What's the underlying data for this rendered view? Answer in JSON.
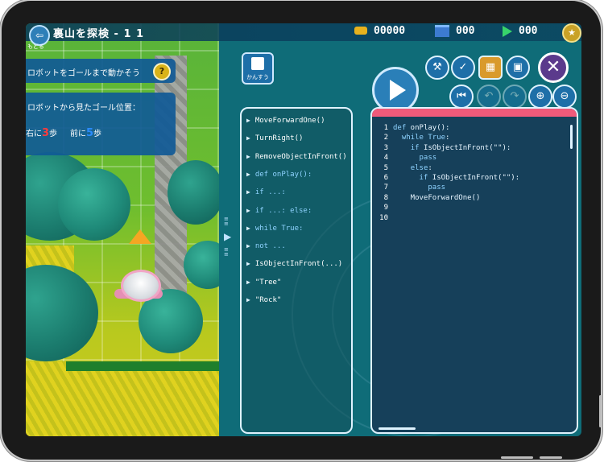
{
  "header": {
    "stage_title": "裏山を探検 - 1 1",
    "back_label": "もどる",
    "coins": "00000",
    "boxes": "000",
    "plays": "000"
  },
  "mission": {
    "text": "ロボットをゴールまで動かそう",
    "help": "?"
  },
  "goal_info": {
    "title": "ロボットから見たゴール位置：",
    "right_prefix": "右に",
    "right_value": "3",
    "right_suffix": "歩",
    "front_prefix": "前に",
    "front_value": "5",
    "front_suffix": "歩"
  },
  "toolbox": {
    "hints_label": "かんすう",
    "items": [
      {
        "text": "MoveForwardOne()",
        "kw": false
      },
      {
        "text": "TurnRight()",
        "kw": false
      },
      {
        "text": "RemoveObjectInFront()",
        "kw": false
      },
      {
        "text": "def onPlay():",
        "kw": true
      },
      {
        "text": "if ...:",
        "kw": true
      },
      {
        "text": "if ...: else:",
        "kw": true
      },
      {
        "text": "while True:",
        "kw": true
      },
      {
        "text": "not ...",
        "kw": true
      },
      {
        "text": "IsObjectInFront(...)",
        "kw": false
      },
      {
        "text": "\"Tree\"",
        "kw": false
      },
      {
        "text": "\"Rock\"",
        "kw": false
      }
    ]
  },
  "editor": {
    "line_numbers": [
      "1",
      "2",
      "3",
      "4",
      "5",
      "6",
      "7",
      "8",
      "9",
      "10"
    ],
    "code_lines": [
      "def onPlay():",
      "  while True:",
      "    if IsObjectInFront(\"\"):",
      "      pass",
      "    else:",
      "      if IsObjectInFront(\"\"):",
      "        pass",
      "    MoveForwardOne()",
      "",
      ""
    ]
  },
  "icons": {
    "back": "back-arrow-icon",
    "coin": "coin-icon",
    "box": "box-icon",
    "play_count": "play-icon",
    "trophy": "trophy-icon",
    "wrench": "wrench-icon",
    "check": "check-icon",
    "folder": "folder-icon",
    "window": "window-icon",
    "close": "close-icon",
    "run": "run-play-icon",
    "rewind": "rewind-icon",
    "undo": "undo-icon",
    "redo": "redo-icon",
    "zoom_in": "zoom-in-icon",
    "zoom_out": "zoom-out-icon"
  },
  "colors": {
    "accent_red": "#ff3b3b",
    "accent_blue": "#2b8cff",
    "editor_strip": "#f05a7a",
    "panel_blue": "#105a96"
  }
}
